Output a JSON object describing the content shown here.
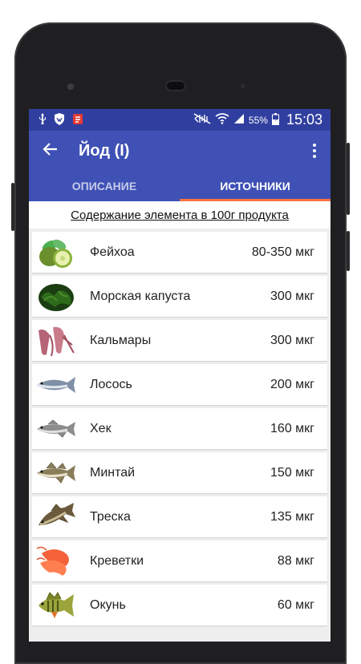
{
  "status_bar": {
    "time": "15:03",
    "battery": "55%",
    "icons": [
      "usb-icon",
      "shield-app-icon",
      "vpn-icon",
      "mute-icon",
      "wifi-icon",
      "signal-icon",
      "battery-icon"
    ]
  },
  "toolbar": {
    "title": "Йод (I)",
    "back_icon": "arrow-back-icon",
    "menu_icon": "overflow-menu-icon"
  },
  "tabs": [
    {
      "label": "ОПИСАНИЕ",
      "active": false
    },
    {
      "label": "ИСТОЧНИКИ",
      "active": true
    }
  ],
  "colors": {
    "status_bar": "#303f9f",
    "primary": "#3f51b5",
    "tab_indicator": "#ff7043",
    "background": "#eeeeee"
  },
  "section_heading": "Содержание элемента в 100г продукта",
  "items": [
    {
      "name": "Фейхоа",
      "amount": "80-350 мкг",
      "icon": "feijoa-icon"
    },
    {
      "name": "Морская капуста",
      "amount": "300 мкг",
      "icon": "seaweed-icon"
    },
    {
      "name": "Кальмары",
      "amount": "300 мкг",
      "icon": "squid-icon"
    },
    {
      "name": "Лосось",
      "amount": "200 мкг",
      "icon": "salmon-icon"
    },
    {
      "name": "Хек",
      "amount": "160 мкг",
      "icon": "hake-icon"
    },
    {
      "name": "Минтай",
      "amount": "150 мкг",
      "icon": "pollock-icon"
    },
    {
      "name": "Треска",
      "amount": "135 мкг",
      "icon": "cod-icon"
    },
    {
      "name": "Креветки",
      "amount": "88 мкг",
      "icon": "shrimp-icon"
    },
    {
      "name": "Окунь",
      "amount": "60 мкг",
      "icon": "perch-icon"
    }
  ]
}
